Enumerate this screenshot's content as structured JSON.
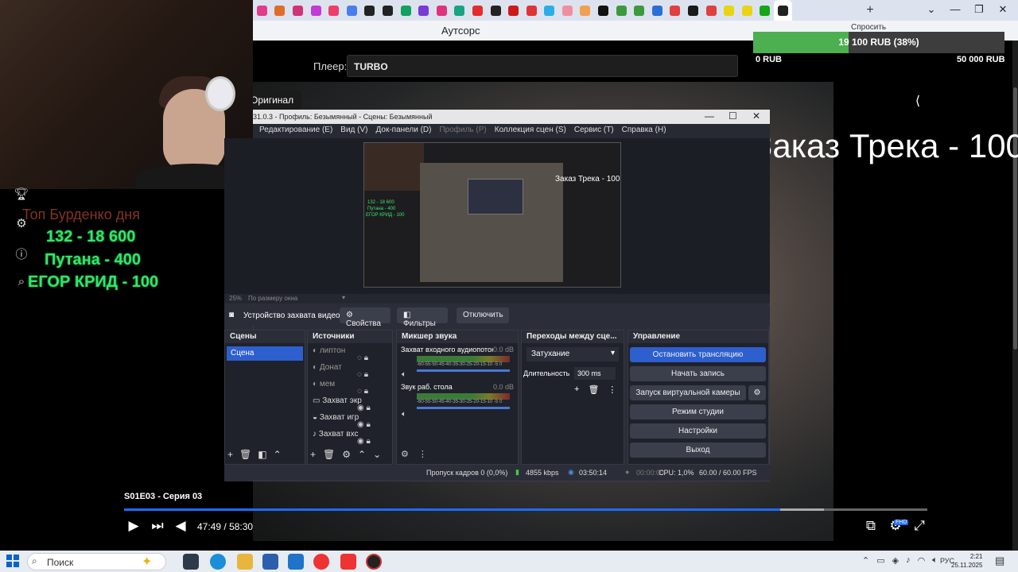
{
  "browser": {
    "page_title": "Аутсорс",
    "new_tab": "+",
    "ask_button": "Спросить",
    "tab_colors": [
      "#e23c8c",
      "#e06c2a",
      "#d0337a",
      "#c23bd4",
      "#ee3d6b",
      "#4a7ef0",
      "#222222",
      "#222222",
      "#14a060",
      "#7a3ad6",
      "#e0347a",
      "#19a383",
      "#e22d2d",
      "#222222",
      "#cc1a1a",
      "#e03434",
      "#2baee6",
      "#f08ea0",
      "#f0a050",
      "#111111",
      "#3c9a3c",
      "#3c9a3c",
      "#2a6fd8",
      "#e04040",
      "#1a1a1a",
      "#e04040",
      "#e8d414",
      "#e8d414",
      "#17a617",
      "#222222"
    ]
  },
  "webcam": {
    "label": "webcam-feed"
  },
  "player": {
    "label": "Плеер:",
    "selected": "TURBO",
    "original_button": "Оригинал",
    "episode": "S01E03 - Серия 03",
    "time_current": "47:49",
    "time_separator": "/",
    "time_total": "58:30",
    "progress_fraction": 0.817,
    "hd_badge": "FHD"
  },
  "donation": {
    "collected": "19 100 RUB (38%)",
    "min": "0 RUB",
    "max": "50 000 RUB",
    "fraction": 0.38
  },
  "overlay": {
    "track_order": "Заказ Трека - 100",
    "top_label": "Топ Бурденко дня",
    "top_items": [
      "132 - 18 600",
      "Путана - 400",
      "ЕГОР КРИД - 100"
    ]
  },
  "obs": {
    "title": "31.0.3 - Профиль: Безымянный - Сцены: Безымянный",
    "menu": [
      "Редактирование (E)",
      "Вид (V)",
      "Док-панели (D)",
      "Профиль (P)",
      "Коллекция сцен (S)",
      "Сервис (T)",
      "Справка (H)"
    ],
    "preview_overlay": "Заказ Трека - 100",
    "preview_list": [
      "132 - 18 600",
      "Путана - 400",
      "ЕГОР КРИД - 100"
    ],
    "zoom": "25%",
    "zoom_mode": "По размеру окна",
    "context": {
      "source_name": "Устройство захвата видео",
      "properties": "Свойства",
      "filters": "Фильтры",
      "deactivate": "Отключить"
    },
    "scenes": {
      "title": "Сцены",
      "items": [
        "Сцена"
      ]
    },
    "sources": {
      "title": "Источники",
      "items": [
        "липтон",
        "Донат",
        "мем",
        "Захват экр",
        "Захват игр",
        "Захват вхс"
      ]
    },
    "mixer": {
      "title": "Микшер звука",
      "channels": [
        {
          "name": "Захват входного аудиопотока",
          "db": "0.0 dB"
        },
        {
          "name": "Звук раб. стола",
          "db": "0.0 dB"
        }
      ],
      "scale": "-60-55-50-45-40-35-30-25-20-15-10 -5 0"
    },
    "transitions": {
      "title": "Переходы между сце...",
      "type": "Затухание",
      "duration_label": "Длительность",
      "duration": "300 ms"
    },
    "controls": {
      "title": "Управление",
      "stop_stream": "Остановить трансляцию",
      "start_record": "Начать запись",
      "virtual_cam": "Запуск виртуальной камеры",
      "studio_mode": "Режим студии",
      "settings": "Настройки",
      "exit": "Выход"
    },
    "status": {
      "dropped": "Пропуск кадров 0 (0,0%)",
      "bitrate": "4855 kbps",
      "stream_time": "03:50:14",
      "rec_time": "00:00:00",
      "cpu": "CPU: 1,0%",
      "fps": "60.00 / 60.00 FPS"
    }
  },
  "taskbar": {
    "search": "Поиск",
    "lang": "РУС",
    "time": "2:21",
    "date": "25.11.2025"
  }
}
